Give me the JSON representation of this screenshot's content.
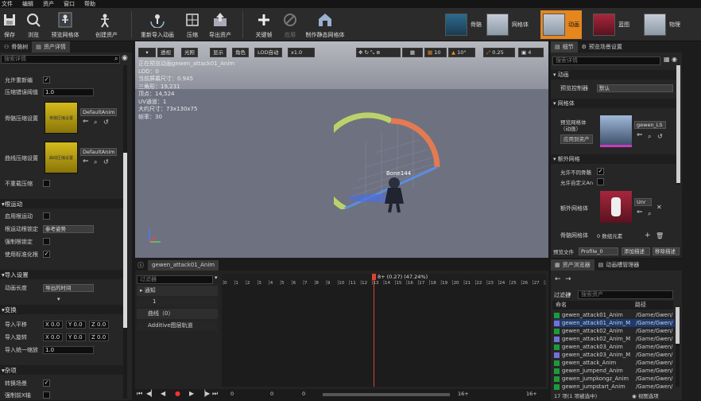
{
  "menu": [
    "文件",
    "编辑",
    "资产",
    "窗口",
    "帮助"
  ],
  "toolbar": [
    {
      "label": "保存",
      "icon": "save-icon"
    },
    {
      "label": "浏览",
      "icon": "browse-icon"
    },
    {
      "label": "预览网格体",
      "icon": "preview-mesh-icon"
    },
    {
      "label": "创建资产",
      "icon": "create-asset-icon"
    },
    {
      "label": "重新导入动画",
      "icon": "reimport-icon"
    },
    {
      "label": "压缩",
      "icon": "compress-icon"
    },
    {
      "label": "导出资产",
      "icon": "export-icon"
    },
    {
      "label": "关键帧",
      "icon": "plus-icon"
    },
    {
      "label": "应用",
      "icon": "apply-icon"
    },
    {
      "label": "制作静态网格体",
      "icon": "static-mesh-icon"
    }
  ],
  "modes": [
    {
      "label": "骨骼"
    },
    {
      "label": "网格体"
    },
    {
      "label": "动画"
    },
    {
      "label": "蓝图"
    },
    {
      "label": "物理"
    }
  ],
  "left": {
    "tabs": [
      "骨骼树",
      "资产详情"
    ],
    "search_placeholder": "搜索详情",
    "props": {
      "allow_rebake": "允许重新编",
      "compression_error": "压缩错误阈值",
      "compression_error_val": "1.0",
      "bone_compression": "骨骼压缩设置",
      "bone_compression_tile": "骨骼压缩设置",
      "curve_compression": "曲线压缩设置",
      "curve_compression_tile": "曲线压缩设置",
      "default_dd": "DefaultAnim",
      "no_compress": "不重载压缩"
    },
    "root_motion": {
      "header": "根运动",
      "enable": "启用根运动",
      "root_lock": "根运动根锁定",
      "root_lock_val": "参考姿势",
      "force_root_lock": "强制根锁定",
      "normalized_scale": "使用标准化根"
    },
    "import": {
      "header": "导入设置",
      "anim_length": "动画长度",
      "anim_length_val": "导出的时间"
    },
    "transform": {
      "header": "变换",
      "translation": "导入平移",
      "rotation": "导入旋转",
      "uniform_scale": "导入统一缩放",
      "scale_val": "1.0",
      "x": "X 0.0",
      "y": "Y 0.0",
      "z": "Z 0.0"
    },
    "misc": {
      "header": "杂项",
      "convert_scene": "转换场景",
      "force_front_x": "强制前X轴"
    }
  },
  "viewport": {
    "buttons": [
      "透视",
      "光照",
      "显示",
      "角色",
      "LOD自动",
      "x1.0"
    ],
    "right_values": [
      "10",
      "10°",
      "0.25",
      "4"
    ],
    "info": [
      "正在预览动画gewen_attack01_Anim",
      "LOD：0",
      "当前屏幕尺寸：0.945",
      "三角形：19,231",
      "顶点：14,524",
      "UV通道：1",
      "大约尺寸：73x130x75",
      "帧率：30"
    ],
    "bone_label": "Bone144"
  },
  "timeline": {
    "tab": "gewen_attack01_Anim",
    "filter_placeholder": "过滤器",
    "tracks": [
      "通知",
      "1",
      "曲线（0）",
      "Additive图层轨道"
    ],
    "ruler_readout": "8+ (0.27) (47.24%)",
    "ruler_ticks": [
      "0",
      "1",
      "2",
      "3",
      "4",
      "5",
      "6",
      "7",
      "8",
      "9",
      "10",
      "11",
      "12",
      "13",
      "14",
      "15",
      "16",
      "17",
      "18",
      "19",
      "20",
      "21",
      "22",
      "23",
      "24",
      "25",
      "26",
      "27",
      "28"
    ],
    "footer_values": [
      "0",
      "0",
      "0",
      "16+",
      "16+"
    ]
  },
  "details": {
    "tabs": [
      "细节",
      "预览场景设置"
    ],
    "search_placeholder": "搜索详情",
    "animation_header": "动画",
    "preview_controller": "预览控制器",
    "preview_controller_val": "默认",
    "mesh_header": "网格体",
    "preview_mesh": "预览网格体（动画）",
    "mesh_dd": "gewen_LS",
    "apply_to_asset": "应用到资产",
    "extra_header": "额外网格",
    "allow_diff_skel": "允许不同骨骼",
    "allow_custom_anim": "允许自定义An",
    "extra_mesh": "额外网格体",
    "extra_mesh_dd": "Unr",
    "skeletal_mesh": "骨骼网格体",
    "array_elements": "0 数组元素",
    "preview_file": "预览文件",
    "profile": "Profile_0",
    "add_desc": "添加描述",
    "remove_desc": "移除描述"
  },
  "assets": {
    "tabs": [
      "资产浏览器",
      "动画槽管理器"
    ],
    "filter": "过滤器",
    "search_placeholder": "搜索资产",
    "col_name": "命名",
    "col_path": "路径",
    "items": [
      {
        "name": "gewen_attack01_Anim",
        "path": "/Game/Gwen/",
        "kind": "a"
      },
      {
        "name": "gewen_attack01_Anim_M",
        "path": "/Game/Gwen/",
        "kind": "b"
      },
      {
        "name": "gewen_attack02_Anim",
        "path": "/Game/Gwen/",
        "kind": "a"
      },
      {
        "name": "gewen_attack02_Anim_M",
        "path": "/Game/Gwen/",
        "kind": "b"
      },
      {
        "name": "gewen_attack03_Anim",
        "path": "/Game/Gwen/",
        "kind": "a"
      },
      {
        "name": "gewen_attack03_Anim_M",
        "path": "/Game/Gwen/",
        "kind": "b"
      },
      {
        "name": "gewen_attack_Anim",
        "path": "/Game/Gwen/",
        "kind": "a"
      },
      {
        "name": "gewen_jumpend_Anim",
        "path": "/Game/Gwen/",
        "kind": "a"
      },
      {
        "name": "gewen_jumpkongz_Anim",
        "path": "/Game/Gwen/",
        "kind": "a"
      },
      {
        "name": "gewen_jumpstart_Anim",
        "path": "/Game/Gwen/",
        "kind": "a"
      }
    ],
    "status": "17 项(1 项被选中)",
    "view_options": "视图选项"
  },
  "colors": {
    "accent": "#e5861e",
    "selected": "#1e3a6e",
    "tile": "#c9b012",
    "bg": "#262626"
  }
}
